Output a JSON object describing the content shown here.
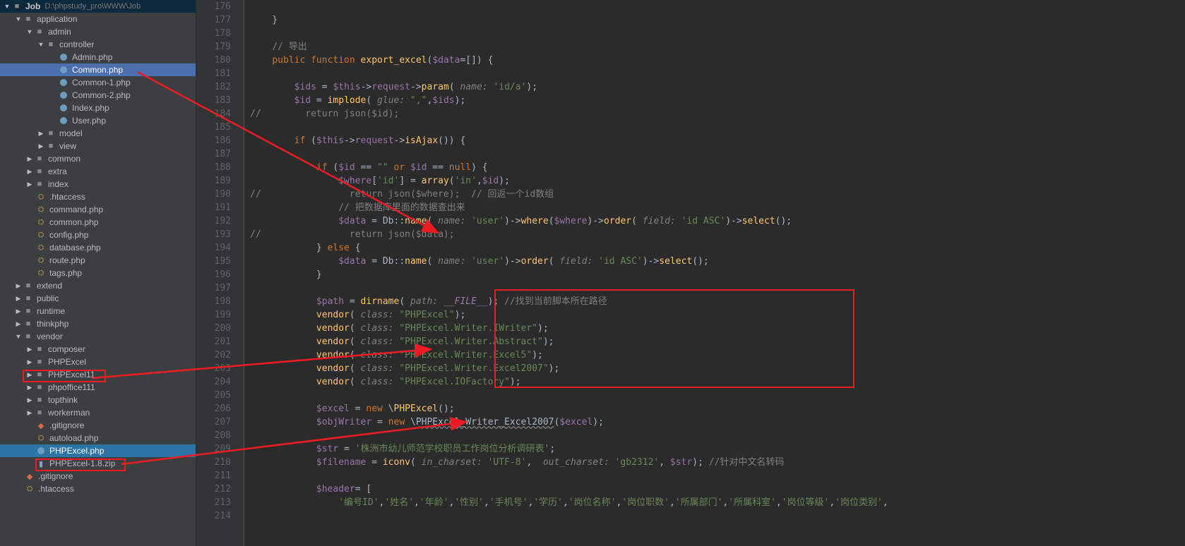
{
  "project": {
    "name": "Job",
    "path": "D:\\phpstudy_pro\\WWW\\Job"
  },
  "tree": {
    "application": {
      "label": "application",
      "admin": {
        "label": "admin",
        "controller": {
          "label": "controller",
          "files": [
            "Admin.php",
            "Common.php",
            "Common-1.php",
            "Common-2.php",
            "Index.php",
            "User.php"
          ]
        },
        "model": "model",
        "view": "view"
      },
      "common": "common",
      "extra": "extra",
      "index": "index",
      "files_php": [
        ".htaccess",
        "command.php",
        "common.php",
        "config.php",
        "database.php",
        "route.php",
        "tags.php"
      ]
    },
    "extend": "extend",
    "public": "public",
    "runtime": "runtime",
    "thinkphp": "thinkphp",
    "vendor": {
      "label": "vendor",
      "dirs": [
        "composer",
        "PHPExcel",
        "PHPExcel11",
        "phpoffice111",
        "topthink",
        "workerman"
      ],
      "files": [
        ".gitignore",
        "autoload.php",
        "PHPExcel.php",
        "PHPExcel-1.8.zip"
      ]
    },
    "root_files": [
      ".gitignore",
      ".htaccess"
    ]
  },
  "code": {
    "lines": [
      {
        "n": 176,
        "html": ""
      },
      {
        "n": 177,
        "html": "    }"
      },
      {
        "n": 178,
        "html": ""
      },
      {
        "n": 179,
        "html": "    <span class='cmt'>// 导出</span>"
      },
      {
        "n": 180,
        "html": "    <span class='kw'>public function</span> <span class='fn'>export_excel</span>(<span class='var'>$data</span>=[]) {"
      },
      {
        "n": 181,
        "html": ""
      },
      {
        "n": 182,
        "html": "        <span class='var'>$ids</span> = <span class='var'>$this</span>-><span class='var'>request</span>-><span class='fn'>param</span>( <span class='param'>name:</span> <span class='str'>'id/a'</span>);"
      },
      {
        "n": 183,
        "html": "        <span class='var'>$id</span> = <span class='fn'>implode</span>( <span class='param'>glue:</span> <span class='str'>\",\"</span>,<span class='var'>$ids</span>);"
      },
      {
        "n": 184,
        "html": "<span class='cmt'>//        return json($id);</span>"
      },
      {
        "n": 185,
        "html": ""
      },
      {
        "n": 186,
        "html": "        <span class='kw'>if</span> (<span class='var'>$this</span>-><span class='var'>request</span>-><span class='fn'>isAjax</span>()) {"
      },
      {
        "n": 187,
        "html": ""
      },
      {
        "n": 188,
        "html": "            <span class='kw'>if</span> (<span class='var'>$id</span> == <span class='str'>\"\"</span> <span class='kw'>or</span> <span class='var'>$id</span> == <span class='kw'>null</span>) {"
      },
      {
        "n": 189,
        "html": "                <span class='var'>$where</span>[<span class='str'>'id'</span>] = <span class='fn'>array</span>(<span class='str'>'in'</span>,<span class='var'>$id</span>);"
      },
      {
        "n": 190,
        "html": "<span class='cmt'>//                return json($where);  // 回返一个id数组</span>"
      },
      {
        "n": 191,
        "html": "                <span class='cmt'>// 把数据库里面的数据查出来</span>"
      },
      {
        "n": 192,
        "html": "                <span class='var'>$data</span> = Db::<span class='fn'>name</span>( <span class='param'>name:</span> <span class='str'>'user'</span>)-><span class='fn'>where</span>(<span class='var'>$where</span>)-><span class='fn'>order</span>( <span class='param'>field:</span> <span class='str'>'id ASC'</span>)-><span class='fn'>select</span>();"
      },
      {
        "n": 193,
        "html": "<span class='cmt'>//                return json($data);</span>"
      },
      {
        "n": 194,
        "html": "            } <span class='kw'>else</span> {"
      },
      {
        "n": 195,
        "html": "                <span class='var'>$data</span> = Db::<span class='fn'>name</span>( <span class='param'>name:</span> <span class='str'>'user'</span>)-><span class='fn'>order</span>( <span class='param'>field:</span> <span class='str'>'id ASC'</span>)-><span class='fn'>select</span>();"
      },
      {
        "n": 196,
        "html": "            }"
      },
      {
        "n": 197,
        "html": ""
      },
      {
        "n": 198,
        "html": "            <span class='var'>$path</span> = <span class='fn'>dirname</span>( <span class='param'>path:</span> <span class='const'>__FILE__</span>); <span class='cmt'>//找到当前脚本所在路径</span>"
      },
      {
        "n": 199,
        "html": "            <span class='fn'>vendor</span>( <span class='param'>class:</span> <span class='str'>\"PHPExcel\"</span>);"
      },
      {
        "n": 200,
        "html": "            <span class='fn'>vendor</span>( <span class='param'>class:</span> <span class='str'>\"PHPExcel.Writer.IWriter\"</span>);"
      },
      {
        "n": 201,
        "html": "            <span class='fn'>vendor</span>( <span class='param'>class:</span> <span class='str'>\"PHPExcel.Writer.Abstract\"</span>);"
      },
      {
        "n": 202,
        "html": "            <span class='fn'>vendor</span>( <span class='param'>class:</span> <span class='str'>\"PHPExcel.Writer.Excel5\"</span>);"
      },
      {
        "n": 203,
        "html": "            <span class='fn'>vendor</span>( <span class='param'>class:</span> <span class='str'>\"PHPExcel.Writer.Excel2007\"</span>);"
      },
      {
        "n": 204,
        "html": "            <span class='fn'>vendor</span>( <span class='param'>class:</span> <span class='str'>\"PHPExcel.IOFactory\"</span>);"
      },
      {
        "n": 205,
        "html": ""
      },
      {
        "n": 206,
        "html": "            <span class='var'>$excel</span> = <span class='kw'>new</span> \\<span class='fn'>PHPExcel</span>();"
      },
      {
        "n": 207,
        "html": "            <span class='var'>$objWriter</span> = <span class='kw'>new</span> \\<span style='text-decoration:underline wavy #808080;'>PHPExcel_Writer_Excel2007</span>(<span class='var'>$excel</span>);"
      },
      {
        "n": 208,
        "html": ""
      },
      {
        "n": 209,
        "html": "            <span class='var'>$str</span> = <span class='str'>'株洲市幼儿师范学校职员工作岗位分析调研表'</span>;"
      },
      {
        "n": 210,
        "html": "            <span class='var'>$filename</span> = <span class='fn'>iconv</span>( <span class='param'>in_charset:</span> <span class='str'>'UTF-8'</span>,  <span class='param'>out_charset:</span> <span class='str'>'gb2312'</span>, <span class='var'>$str</span>); <span class='cmt'>//针对中文名转码</span>"
      },
      {
        "n": 211,
        "html": ""
      },
      {
        "n": 212,
        "html": "            <span class='var'>$header</span>= ["
      },
      {
        "n": 213,
        "html": "                <span class='str'>'编号ID'</span>,<span class='str'>'姓名'</span>,<span class='str'>'年龄'</span>,<span class='str'>'性别'</span>,<span class='str'>'手机号'</span>,<span class='str'>'学历'</span>,<span class='str'>'岗位名称'</span>,<span class='str'>'岗位职数'</span>,<span class='str'>'所属部门'</span>,<span class='str'>'所属科室'</span>,<span class='str'>'岗位等级'</span>,<span class='str'>'岗位类别'</span>,"
      },
      {
        "n": 214,
        "html": ""
      }
    ]
  }
}
